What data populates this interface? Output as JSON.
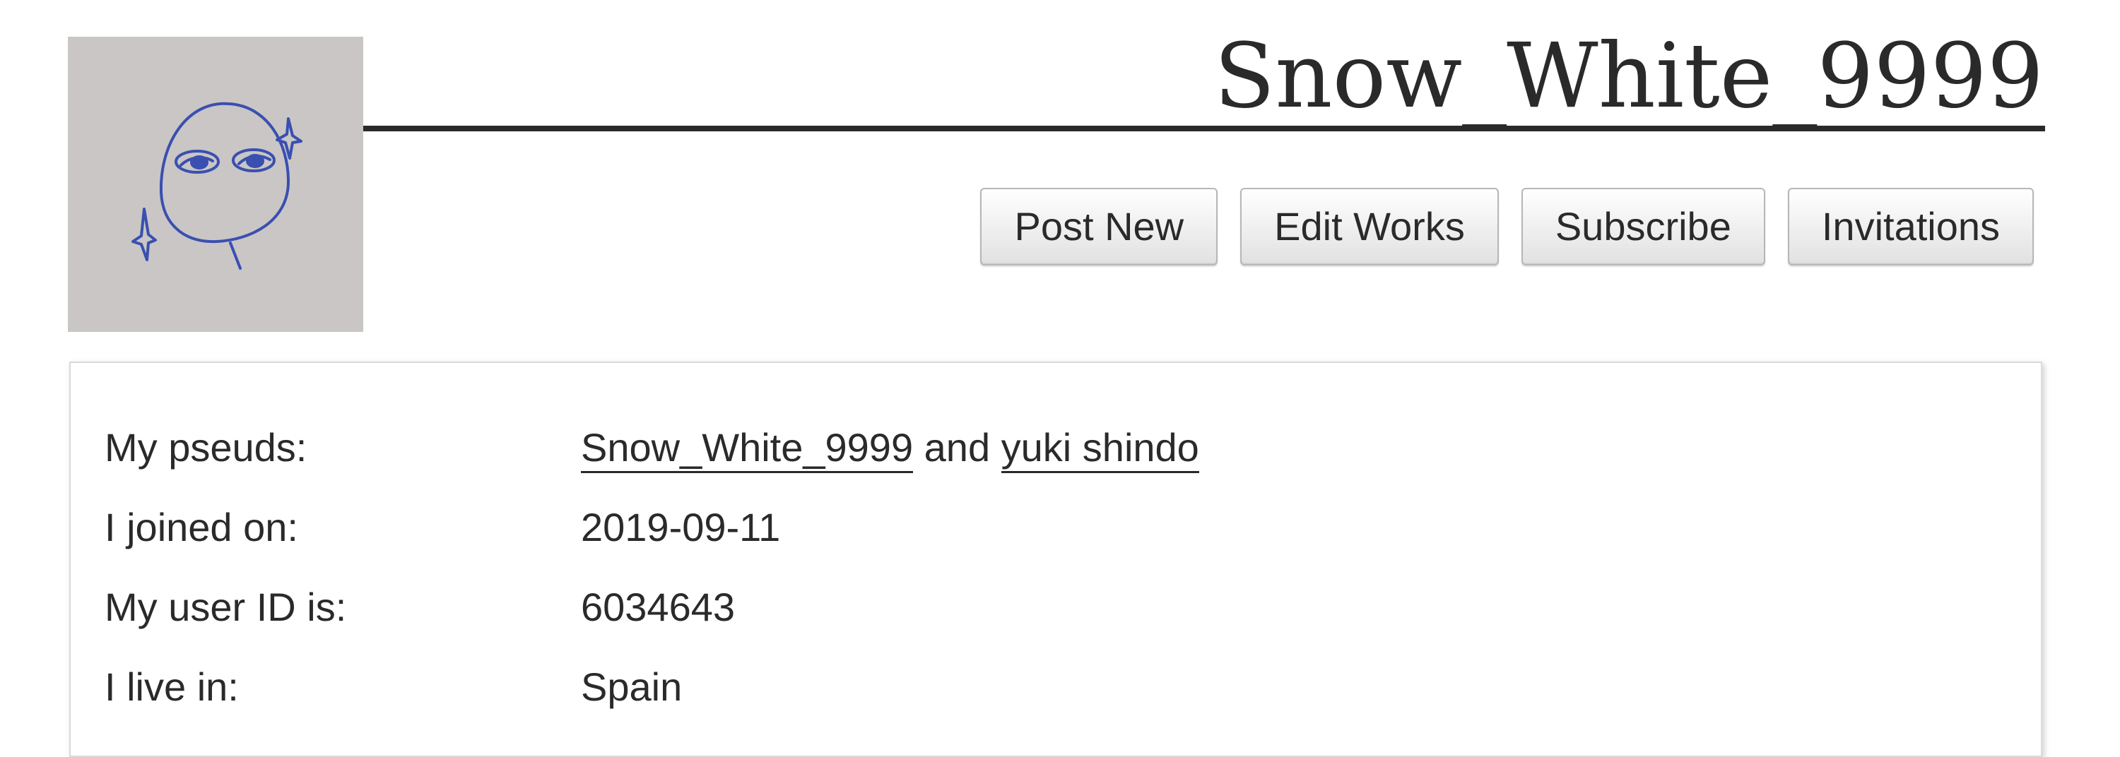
{
  "profile": {
    "username": "Snow_White_9999",
    "avatar_icon": "hand-drawn-egg-face-avatar"
  },
  "actions": {
    "post_new": "Post New",
    "edit_works": "Edit Works",
    "subscribe": "Subscribe",
    "invitations": "Invitations"
  },
  "meta": {
    "pseuds_label": "My pseuds:",
    "pseuds": [
      "Snow_White_9999",
      "yuki shindo"
    ],
    "pseuds_joiner": "and",
    "joined_label": "I joined on:",
    "joined_value": "2019-09-11",
    "user_id_label": "My user ID is:",
    "user_id_value": "6034643",
    "location_label": "I live in:",
    "location_value": "Spain"
  },
  "colors": {
    "text": "#2a2a2a",
    "avatar_background": "#c9c6c5",
    "avatar_ink": "#3a4fb0",
    "panel_border": "#dadada"
  }
}
